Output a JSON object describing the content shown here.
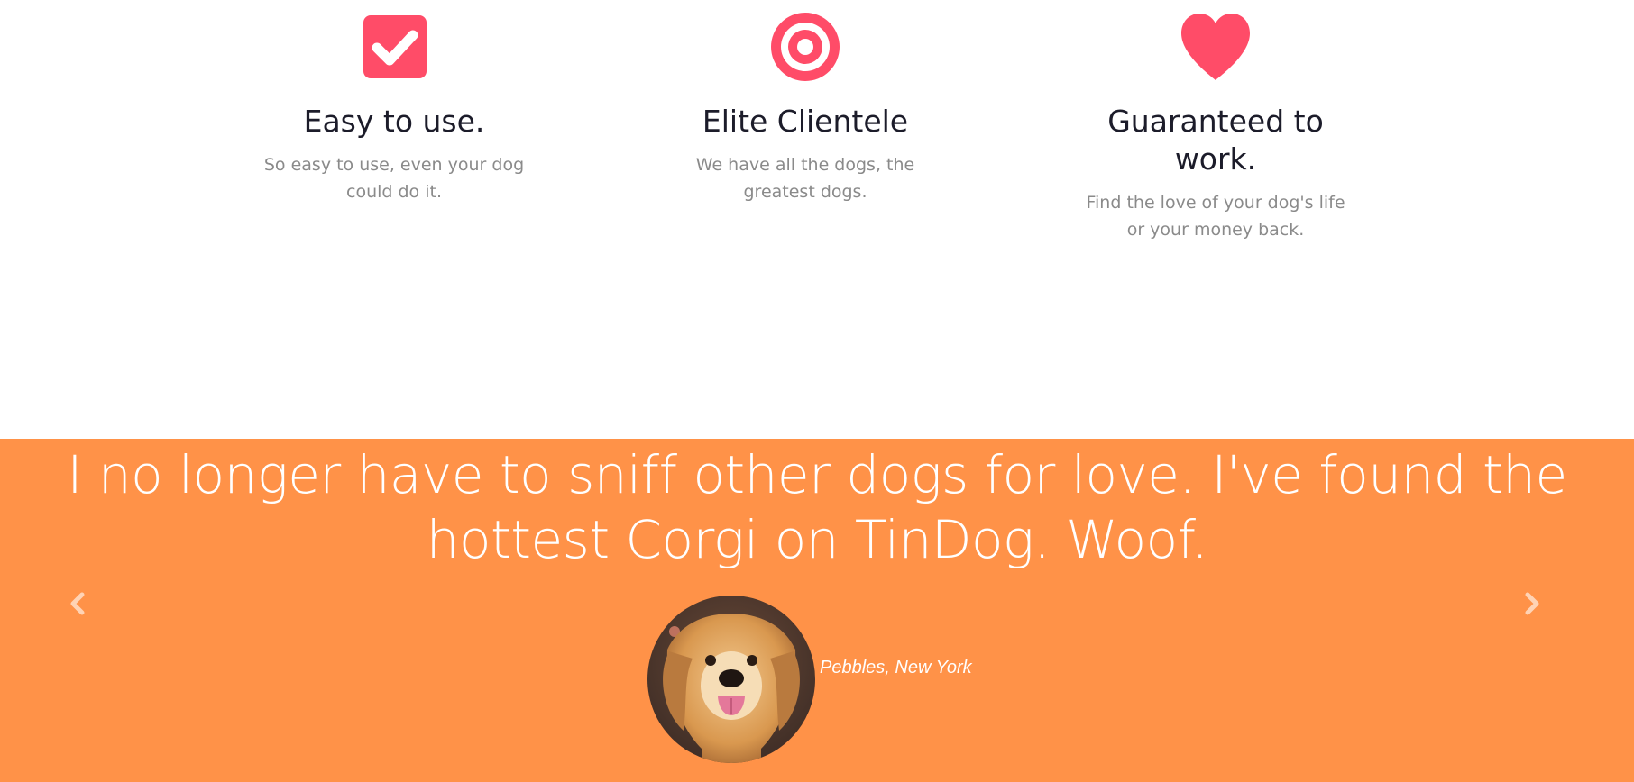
{
  "features": [
    {
      "icon": "check-square-icon",
      "title": "Easy to use.",
      "text": "So easy to use, even your dog could do it."
    },
    {
      "icon": "bullseye-icon",
      "title": "Elite Clientele",
      "text": "We have all the dogs, the greatest dogs."
    },
    {
      "icon": "heart-icon",
      "title": "Guaranteed to work.",
      "text": "Find the love of your dog's life or your money back."
    }
  ],
  "testimonial": {
    "quote": "I no longer have to sniff other dogs for love. I've found the hottest Corgi on TinDog. Woof.",
    "author": "Pebbles, New York",
    "avatar_alt": "dog-profile"
  },
  "colors": {
    "accent": "#ff4c68",
    "testimonial_bg": "#ff9248",
    "heading": "#1c1c2a",
    "muted": "#8a8a8a"
  }
}
